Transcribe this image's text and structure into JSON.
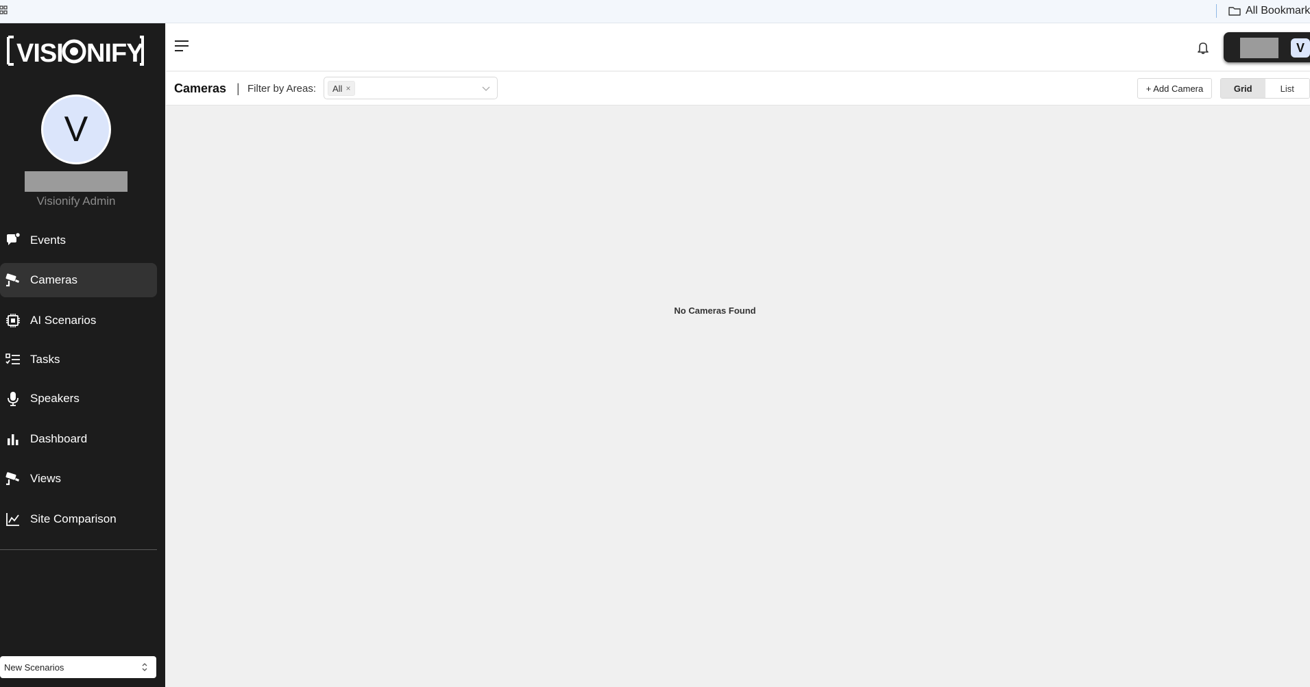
{
  "browser": {
    "bookmarks_folder": "All Bookmarks"
  },
  "sidebar": {
    "logo_text": "[VISIONIFY]",
    "avatar_initial": "V",
    "role": "Visionify Admin",
    "nav": [
      {
        "label": "Events",
        "icon": "events-icon",
        "active": false
      },
      {
        "label": "Cameras",
        "icon": "camera-icon",
        "active": true
      },
      {
        "label": "AI Scenarios",
        "icon": "chip-icon",
        "active": false
      },
      {
        "label": "Tasks",
        "icon": "tasks-icon",
        "active": false
      },
      {
        "label": "Speakers",
        "icon": "microphone-icon",
        "active": false
      },
      {
        "label": "Dashboard",
        "icon": "bar-chart-icon",
        "active": false
      },
      {
        "label": "Views",
        "icon": "camera-icon",
        "active": false
      },
      {
        "label": "Site Comparison",
        "icon": "line-chart-icon",
        "active": false
      }
    ],
    "scenario_select": "New Scenarios"
  },
  "header": {
    "user_initial": "V"
  },
  "toolbar": {
    "title": "Cameras",
    "separator": "|",
    "filter_label": "Filter by Areas:",
    "filter_tag": "All",
    "tag_close": "×",
    "add_camera": "+ Add Camera",
    "view_grid": "Grid",
    "view_list": "List",
    "active_view": "Grid"
  },
  "main": {
    "empty_message": "No Cameras Found"
  }
}
